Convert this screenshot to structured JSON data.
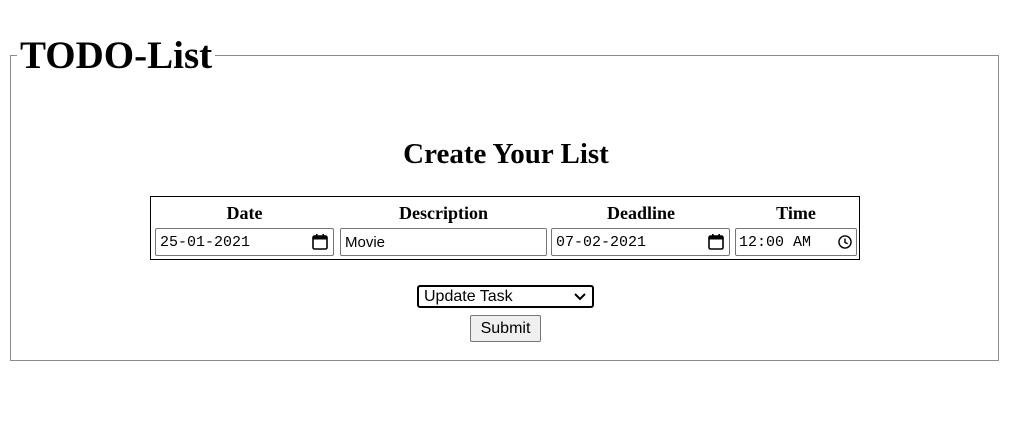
{
  "legend": "TODO-List",
  "subtitle": "Create Your List",
  "columns": {
    "date": "Date",
    "description": "Description",
    "deadline": "Deadline",
    "time": "Time"
  },
  "inputs": {
    "date_value": "25-01-2021",
    "description_value": "Movie",
    "deadline_value": "07-02-2021",
    "time_value": "12:00 AM"
  },
  "action_select": {
    "selected": "Update Task"
  },
  "submit_label": "Submit",
  "icons": {
    "date": "calendar-icon",
    "deadline": "calendar-icon",
    "time": "clock-icon",
    "select": "chevron-down-icon"
  }
}
